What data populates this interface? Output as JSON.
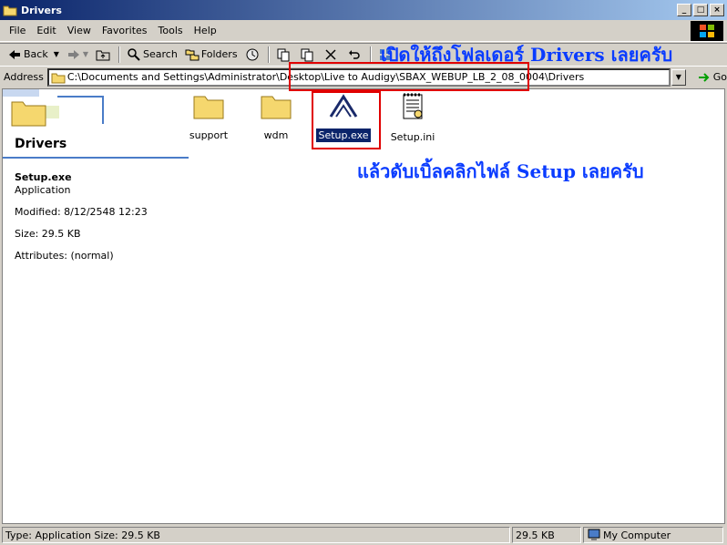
{
  "window": {
    "title": "Drivers"
  },
  "menu": {
    "items": [
      "File",
      "Edit",
      "View",
      "Favorites",
      "Tools",
      "Help"
    ]
  },
  "toolbar": {
    "back": "Back",
    "search": "Search",
    "folders": "Folders"
  },
  "address": {
    "label": "Address",
    "path": "C:\\Documents and Settings\\Administrator\\Desktop\\Live to Audigy\\SBAX_WEBUP_LB_2_08_0004\\Drivers",
    "go": "Go"
  },
  "pane": {
    "title": "Drivers",
    "file_name": "Setup.exe",
    "file_type": "Application",
    "modified": "Modified: 8/12/2548 12:23",
    "size": "Size: 29.5 KB",
    "attributes": "Attributes: (normal)"
  },
  "files": [
    {
      "name": "support",
      "type": "folder"
    },
    {
      "name": "wdm",
      "type": "folder"
    },
    {
      "name": "Setup.exe",
      "type": "exe",
      "selected": true
    },
    {
      "name": "Setup.ini",
      "type": "ini"
    }
  ],
  "annotations": {
    "top": "เปิดให้ถึงโฟลเดอร์ Drivers เลยครับ",
    "middle": "แล้วดับเบิ้ลคลิกไฟล์ Setup เลยครับ"
  },
  "status": {
    "info": "Type: Application Size: 29.5 KB",
    "size": "29.5 KB",
    "zone": "My Computer"
  },
  "colors": {
    "title_bar": "#0a246a",
    "annotation": "#0a3cff",
    "highlight": "#e00000"
  }
}
